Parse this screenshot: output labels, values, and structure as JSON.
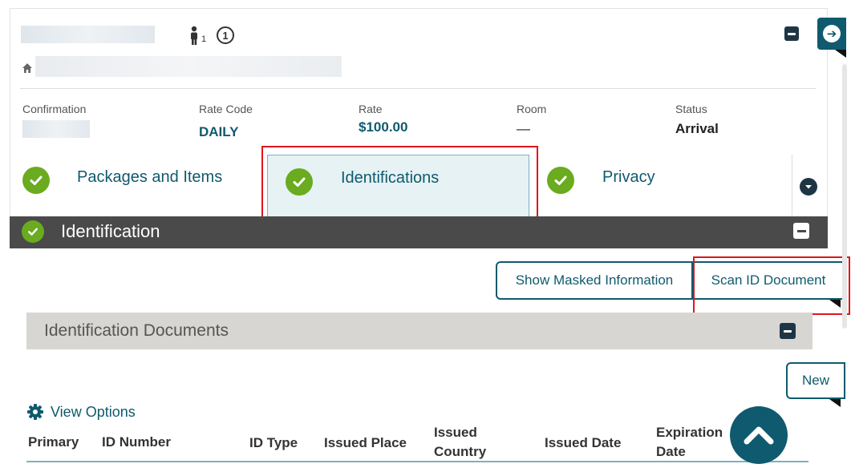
{
  "reservation": {
    "guest_count": "1",
    "info_glyph": "1",
    "fields": [
      {
        "label": "Confirmation",
        "value": ""
      },
      {
        "label": "Rate Code",
        "value": "DAILY"
      },
      {
        "label": "Rate",
        "value": "$100.00"
      },
      {
        "label": "Room",
        "value": "—"
      },
      {
        "label": "Status",
        "value": "Arrival"
      }
    ]
  },
  "section_tabs": [
    {
      "label": "Packages and Items",
      "complete": true
    },
    {
      "label": "Identifications",
      "complete": true,
      "selected": true
    },
    {
      "label": "Privacy",
      "complete": true
    }
  ],
  "identification": {
    "title": "Identification",
    "show_masked_label": "Show Masked Information",
    "scan_id_label": "Scan ID Document"
  },
  "documents": {
    "title": "Identification Documents",
    "new_label": "New",
    "view_options_label": "View Options",
    "columns": [
      "Primary",
      "ID Number",
      "ID Type",
      "Issued Place",
      "Issued Country",
      "Issued Date",
      "Expiration Date"
    ]
  },
  "icons": {
    "guest": "person-icon",
    "info": "circled-one-icon",
    "home": "home-icon",
    "nav": "arrow-right-circle-icon",
    "check": "check-circle-icon",
    "collapse": "minus-square-icon",
    "expand": "chevron-down-circle-icon",
    "settings": "gear-icon",
    "scroll_top": "chevron-up-icon"
  },
  "colors": {
    "accent": "#0f5a6e",
    "success": "#6aab1f",
    "highlight_border": "#e0151b",
    "section_bar": "#4a4a4a",
    "panel_bar": "#d8d6d3"
  }
}
